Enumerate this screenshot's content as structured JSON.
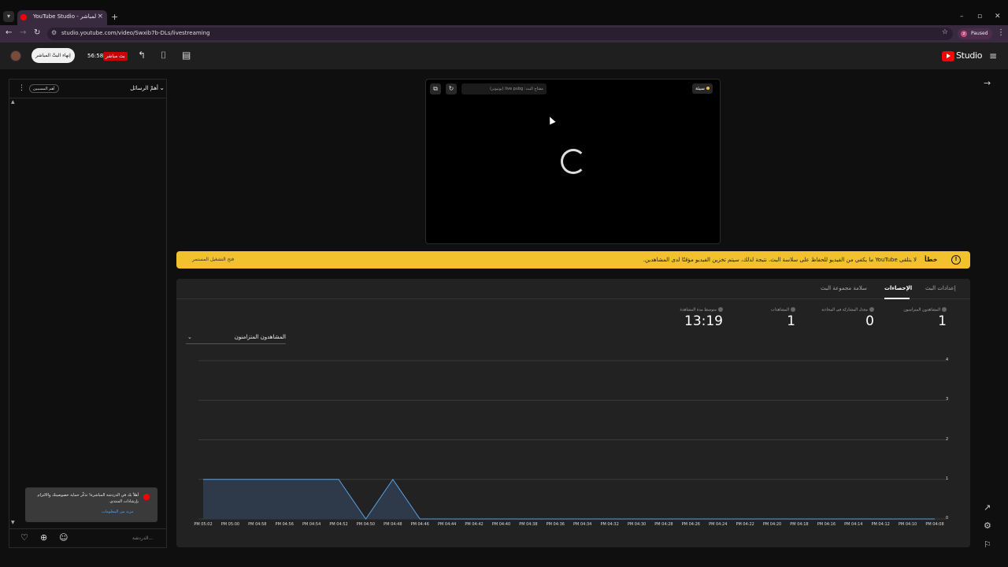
{
  "browser": {
    "tab_title": "YouTube Studio - البثّ المباشر",
    "url": "studio.youtube.com/video/Swxib7b-DLs/livestreaming",
    "profile_label": "Paused",
    "profile_initial": "z"
  },
  "header": {
    "studio_label": "Studio",
    "live_badge": "بث مباشر",
    "live_time": "56:58",
    "end_stream_label": "إنهاء البثّ المباشر"
  },
  "chat": {
    "mode_label": "أهمّ الرسائل",
    "top_donors_label": "أهم المسببين",
    "notice_text": "أهلاً بك في الدردشة المباشرة! تذكّر حماية خصوصيتك والالتزام بإرشادات المنتدى.",
    "notice_link": "مزيد من المعلومات",
    "input_placeholder": "الدردشة..."
  },
  "preview": {
    "status": "سيئة",
    "stream_key_label": "مفتاح البث: live pubg (يوتيوتر)"
  },
  "banner": {
    "title": "خطأ",
    "message": "لا يتلقى YouTube ما يكفي من الفيديو للحفاظ على سلاسة البث. نتيجة لذلك، سيتم تخزين الفيديو مؤقتًا لدى المشاهدين.",
    "link": "فتح التشغيل المستمر"
  },
  "tabs": [
    {
      "label": "إعدادات البث",
      "active": false
    },
    {
      "label": "الإحصاءات",
      "active": true
    },
    {
      "label": "سلامة مجموعة البث",
      "active": false
    }
  ],
  "stats": [
    {
      "label": "المشاهدون المتزامنون",
      "value": "1"
    },
    {
      "label": "معدل المشاركة في المحادثة",
      "value": "0"
    },
    {
      "label": "المشاهدات",
      "value": "1"
    },
    {
      "label": "متوسط مدة المشاهدة",
      "value": "13:19"
    }
  ],
  "metric_select": "المشاهدون المتزامنون",
  "colors": {
    "accent_red": "#ff0000",
    "warning_yellow": "#f2c12e",
    "chart_fill": "#2e3a4a",
    "chart_line": "#5aa0e0"
  },
  "chart_data": {
    "type": "area",
    "ylim": [
      0,
      4
    ],
    "yticks": [
      0,
      1,
      2,
      3,
      4
    ],
    "x": [
      "PM 05:02",
      "PM 05:00",
      "PM 04:58",
      "PM 04:56",
      "PM 04:54",
      "PM 04:52",
      "PM 04:50",
      "PM 04:48",
      "PM 04:46",
      "PM 04:44",
      "PM 04:42",
      "PM 04:40",
      "PM 04:38",
      "PM 04:36",
      "PM 04:34",
      "PM 04:32",
      "PM 04:30",
      "PM 04:28",
      "PM 04:26",
      "PM 04:24",
      "PM 04:22",
      "PM 04:20",
      "PM 04:18",
      "PM 04:16",
      "PM 04:14",
      "PM 04:12",
      "PM 04:10",
      "PM 04:08"
    ],
    "series": [
      {
        "values": [
          1,
          1,
          1,
          1,
          1,
          1,
          0,
          1,
          0,
          0,
          0,
          0,
          0,
          0,
          0,
          0,
          0,
          0,
          0,
          0,
          0,
          0,
          0,
          0,
          0,
          0,
          0,
          0
        ]
      }
    ]
  }
}
